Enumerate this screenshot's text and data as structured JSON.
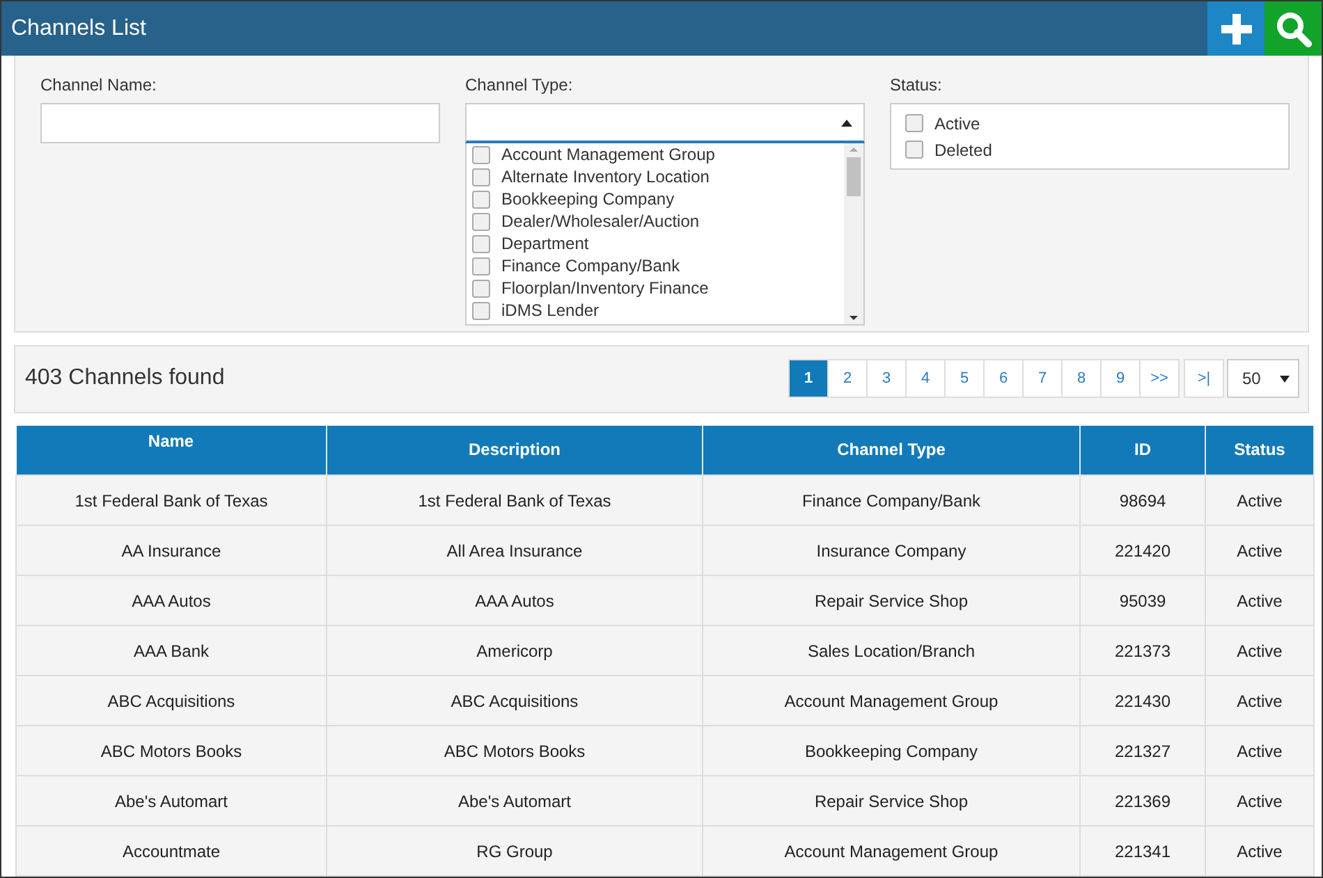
{
  "header": {
    "title": "Channels List"
  },
  "filters": {
    "channel_name": {
      "label": "Channel Name:"
    },
    "channel_type": {
      "label": "Channel Type:",
      "expanded": true,
      "options": [
        {
          "label": "Account Management Group",
          "checked": false
        },
        {
          "label": "Alternate Inventory Location",
          "checked": false
        },
        {
          "label": "Bookkeeping Company",
          "checked": false
        },
        {
          "label": "Dealer/Wholesaler/Auction",
          "checked": false
        },
        {
          "label": "Department",
          "checked": false
        },
        {
          "label": "Finance Company/Bank",
          "checked": false
        },
        {
          "label": "Floorplan/Inventory Finance",
          "checked": false
        },
        {
          "label": "iDMS Lender",
          "checked": false
        }
      ]
    },
    "status": {
      "label": "Status:",
      "options": [
        {
          "label": "Active",
          "checked": false
        },
        {
          "label": "Deleted",
          "checked": false
        }
      ]
    }
  },
  "results": {
    "count": "403 Channels found",
    "pages": [
      {
        "label": "1",
        "selected": true
      },
      {
        "label": "2",
        "selected": false
      },
      {
        "label": "3",
        "selected": false
      },
      {
        "label": "4",
        "selected": false
      },
      {
        "label": "5",
        "selected": false
      },
      {
        "label": "6",
        "selected": false
      },
      {
        "label": "7",
        "selected": false
      },
      {
        "label": "8",
        "selected": false
      },
      {
        "label": "9",
        "selected": false
      },
      {
        "label": ">>",
        "selected": false
      }
    ],
    "last": ">|",
    "page_size": "50"
  },
  "table": {
    "columns": [
      "Name",
      "Description",
      "Channel Type",
      "ID",
      "Status"
    ],
    "rows": [
      [
        "1st Federal Bank of Texas",
        "1st Federal Bank of Texas",
        "Finance Company/Bank",
        "98694",
        "Active"
      ],
      [
        "AA Insurance",
        "All Area Insurance",
        "Insurance Company",
        "221420",
        "Active"
      ],
      [
        "AAA Autos",
        "AAA Autos",
        "Repair Service Shop",
        "95039",
        "Active"
      ],
      [
        "AAA Bank",
        "Americorp",
        "Sales Location/Branch",
        "221373",
        "Active"
      ],
      [
        "ABC Acquisitions",
        "ABC Acquisitions",
        "Account Management Group",
        "221430",
        "Active"
      ],
      [
        "ABC Motors Books",
        "ABC Motors Books",
        "Bookkeeping Company",
        "221327",
        "Active"
      ],
      [
        "Abe's Automart",
        "Abe's Automart",
        "Repair Service Shop",
        "221369",
        "Active"
      ],
      [
        "Accountmate",
        "RG Group",
        "Account Management Group",
        "221341",
        "Active"
      ]
    ]
  }
}
